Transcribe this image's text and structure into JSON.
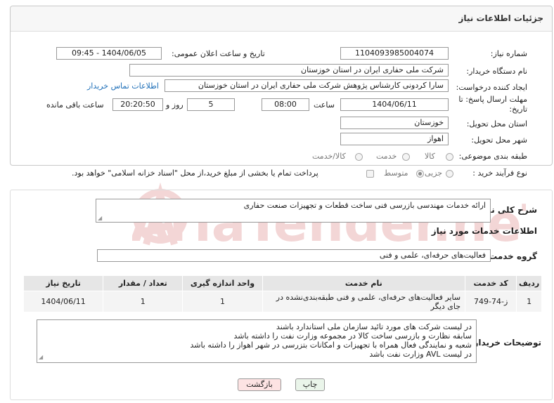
{
  "header": {
    "title": "جزئیات اطلاعات نیاز"
  },
  "fields": {
    "need_number_label": "شماره نیاز:",
    "need_number": "1104093985004074",
    "announce_label": "تاریخ و ساعت اعلان عمومی:",
    "announce_value": "1404/06/05 - 09:45",
    "buyer_org_label": "نام دستگاه خریدار:",
    "buyer_org": "شرکت ملی حفاری ایران در استان خوزستان",
    "requester_label": "ایجاد کننده درخواست:",
    "requester": "سارا کردونی کارشناس پژوهش شرکت ملی حفاری ایران در استان خوزستان",
    "contact_link": "اطلاعات تماس خریدار",
    "deadline_label": "مهلت ارسال پاسخ: تا تاریخ:",
    "deadline_date": "1404/06/11",
    "time_label": "ساعت",
    "deadline_time": "08:00",
    "days_value": "5",
    "days_label": "روز و",
    "remaining_time": "20:20:50",
    "remaining_label": "ساعت باقی مانده",
    "province_label": "استان محل تحویل:",
    "province": "خوزستان",
    "city_label": "شهر محل تحویل:",
    "city": "اهواز",
    "category_label": "طبقه بندی موضوعی:",
    "category_options": [
      "کالا",
      "خدمت",
      "کالا/خدمت"
    ],
    "process_label": "نوع فرآیند خرید :",
    "process_options": [
      "جزیی",
      "متوسط"
    ],
    "payment_note": "پرداخت تمام یا بخشی از مبلغ خرید،از محل \"اسناد خزانه اسلامی\" خواهد بود."
  },
  "summary": {
    "label": "شرح کلی نیاز:",
    "text": "ارائه خدمات مهندسی بازرسی فنی ساخت قطعات و تجهیزات صنعت حفاری"
  },
  "services": {
    "section_title": "اطلاعات خدمات مورد نیاز",
    "group_label": "گروه خدمت:",
    "group_value": "فعالیت‌های حرفه‌ای، علمی و فنی",
    "columns": [
      "ردیف",
      "کد خدمت",
      "نام خدمت",
      "واحد اندازه گیری",
      "تعداد / مقدار",
      "تاریخ نیاز"
    ],
    "rows": [
      {
        "index": "1",
        "code": "ز-74-749",
        "name": "سایر فعالیت‌های حرفه‌ای، علمی و فنی طبقه‌بندی‌نشده در جای دیگر",
        "unit": "1",
        "qty": "1",
        "date": "1404/06/11"
      }
    ]
  },
  "buyer_notes": {
    "label": "توضیحات خریدار:",
    "lines": [
      "در لیست شرکت های مورد تائید سازمان ملی استاندارد باشند",
      "سابقه نظارت و بازرسی ساخت کالا در مجموعه وزارت نفت را داشته باشد",
      "شعبه و نمایندگی فعال همراه با تجهیزات و امکانات بتزرسی در شهر اهواز را داشته باشد",
      "در لیست AVL وزارت نفت باشد"
    ]
  },
  "buttons": {
    "print": "چاپ",
    "back": "بازگشت"
  },
  "watermark": {
    "text": "AriaTender.neT"
  },
  "colors": {
    "link": "#1e6fb8",
    "back_bg": "#fde3e3",
    "print_bg": "#eaf5ea",
    "watermark": "#f3d6d6"
  }
}
